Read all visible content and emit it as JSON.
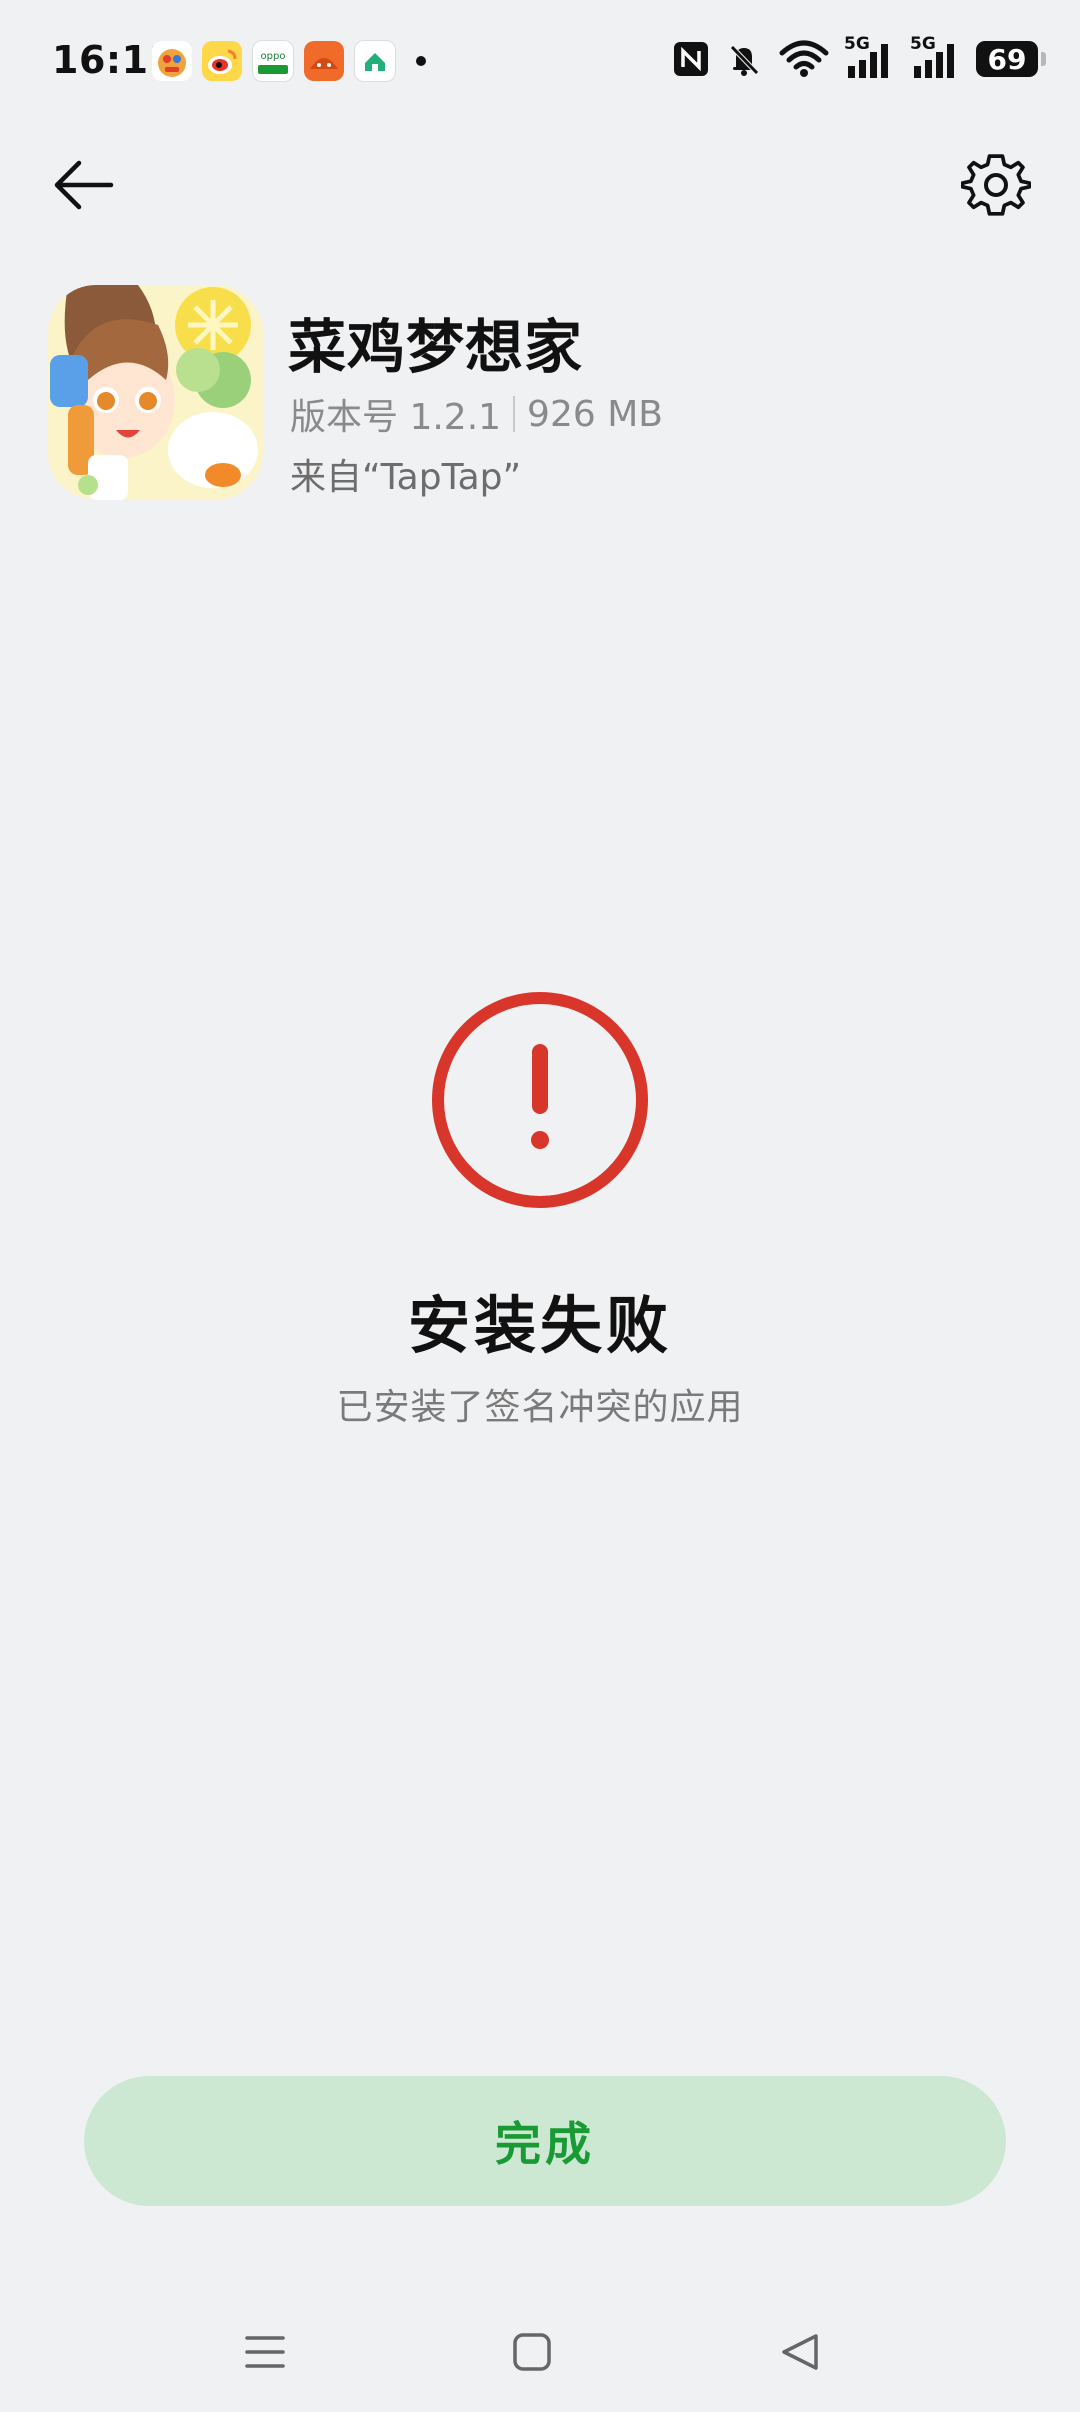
{
  "status_bar": {
    "time": "16:11",
    "battery": "69",
    "signal_label_1": "5G",
    "signal_label_2": "5G"
  },
  "app": {
    "name": "菜鸡梦想家",
    "version": "版本号 1.2.1",
    "size": "926 MB",
    "source": "来自“TapTap”"
  },
  "status": {
    "title": "安装失败",
    "subtitle": "已安装了签名冲突的应用",
    "color": "#d9362b"
  },
  "actions": {
    "done_label": "完成",
    "done_bg": "#cce8d2",
    "done_fg": "#1a9a35"
  },
  "icons": {
    "back": "arrow-left-icon",
    "settings": "gear-icon",
    "error": "exclamation-circle-icon",
    "nav_menu": "menu-icon",
    "nav_home": "square-home-icon",
    "nav_back": "triangle-back-icon"
  }
}
